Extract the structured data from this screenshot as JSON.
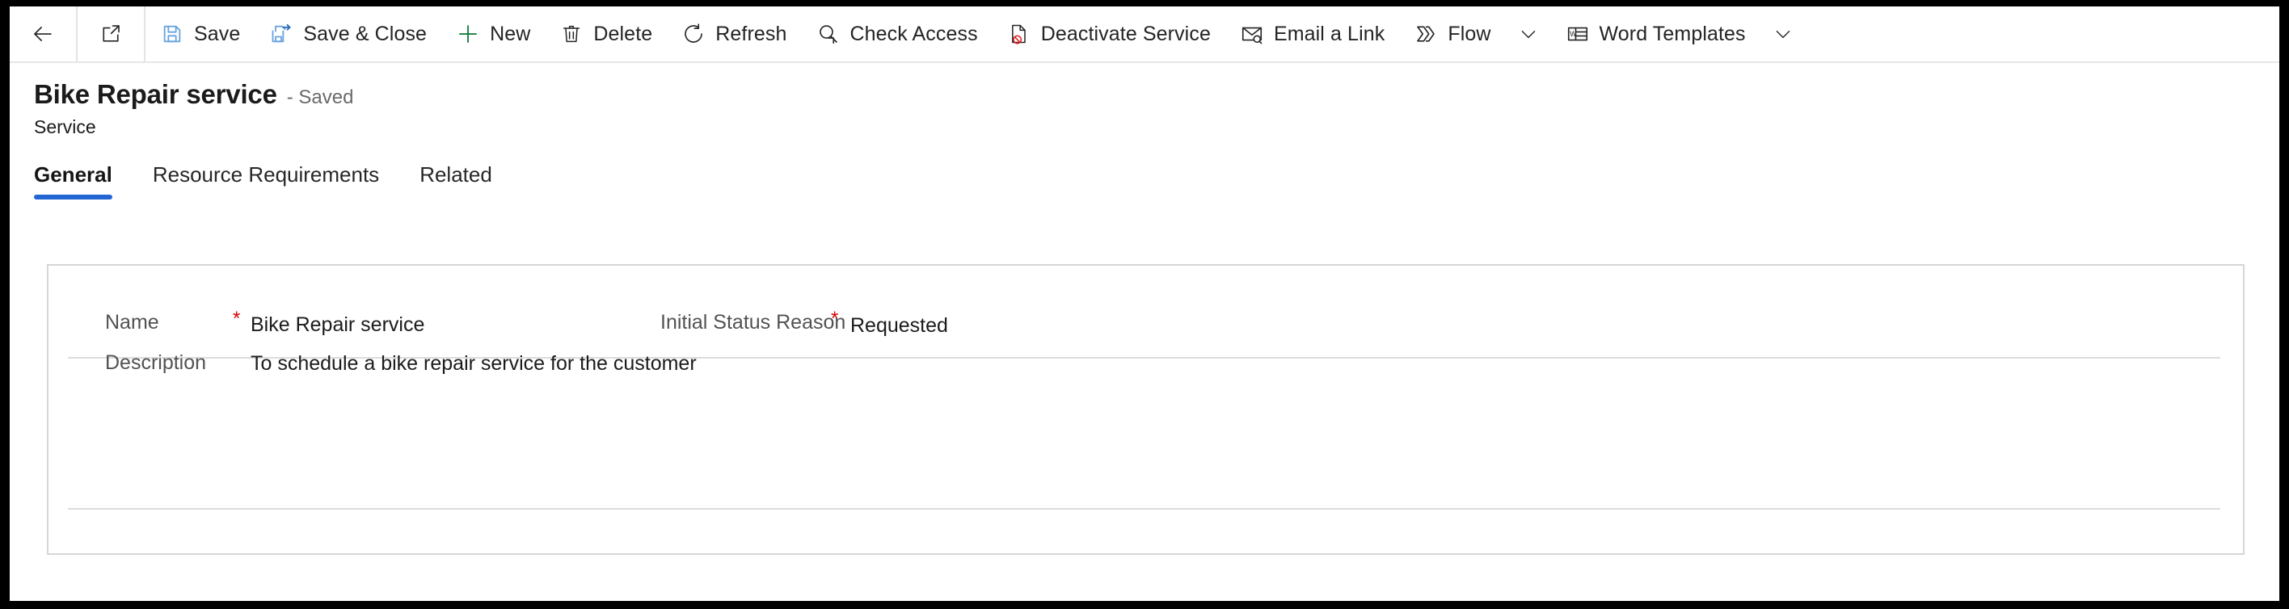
{
  "commandbar": {
    "buttons": [
      {
        "id": "back",
        "label": "",
        "icon": "back-arrow-icon",
        "icon_only": true,
        "caret": false
      },
      {
        "id": "popout",
        "label": "",
        "icon": "open-in-new-window-icon",
        "icon_only": true,
        "caret": false
      },
      {
        "id": "save",
        "label": "Save",
        "icon": "save-icon",
        "icon_only": false,
        "caret": false
      },
      {
        "id": "save-close",
        "label": "Save & Close",
        "icon": "save-and-close-icon",
        "icon_only": false,
        "caret": false
      },
      {
        "id": "new",
        "label": "New",
        "icon": "plus-icon",
        "icon_only": false,
        "caret": false
      },
      {
        "id": "delete",
        "label": "Delete",
        "icon": "trash-icon",
        "icon_only": false,
        "caret": false
      },
      {
        "id": "refresh",
        "label": "Refresh",
        "icon": "refresh-icon",
        "icon_only": false,
        "caret": false
      },
      {
        "id": "check-access",
        "label": "Check Access",
        "icon": "check-access-icon",
        "icon_only": false,
        "caret": false
      },
      {
        "id": "deactivate-service",
        "label": "Deactivate Service",
        "icon": "deactivate-icon",
        "icon_only": false,
        "caret": false
      },
      {
        "id": "email-a-link",
        "label": "Email a Link",
        "icon": "email-link-icon",
        "icon_only": false,
        "caret": false
      },
      {
        "id": "flow",
        "label": "Flow",
        "icon": "flow-icon",
        "icon_only": false,
        "caret": true
      },
      {
        "id": "word-templates",
        "label": "Word Templates",
        "icon": "word-template-icon",
        "icon_only": false,
        "caret": true
      }
    ]
  },
  "header": {
    "record_title": "Bike Repair service",
    "saved_state": "- Saved",
    "entity_name": "Service"
  },
  "tabs": [
    {
      "id": "general",
      "label": "General",
      "active": true
    },
    {
      "id": "resource-requirements",
      "label": "Resource Requirements",
      "active": false
    },
    {
      "id": "related",
      "label": "Related",
      "active": false
    }
  ],
  "form": {
    "fields": {
      "name": {
        "label": "Name",
        "required_marker": "*",
        "value": "Bike Repair service"
      },
      "initial_status_reason": {
        "label": "Initial Status Reason",
        "required_marker": "*",
        "value": "Requested"
      },
      "description": {
        "label": "Description",
        "required_marker": "",
        "value": "To schedule a bike repair service for the customer"
      }
    }
  },
  "colors": {
    "accent": "#2266d3",
    "required": "#d60000",
    "text_primary": "#1b1b1b",
    "text_secondary": "#525252",
    "border": "#d6d6d6",
    "save_icon": "#6aa4de",
    "new_icon": "#15803d",
    "deactivate_icon": "#e02020"
  }
}
